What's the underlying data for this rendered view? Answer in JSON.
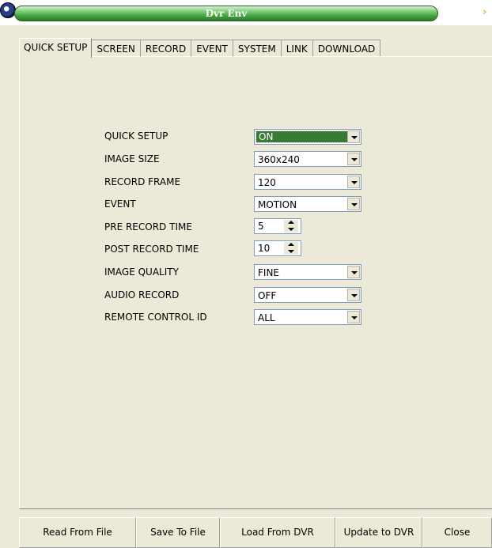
{
  "window": {
    "title": "Dvr Env",
    "close_glyph": "›"
  },
  "tabs": [
    {
      "label": "QUICK SETUP",
      "active": true
    },
    {
      "label": "SCREEN",
      "active": false
    },
    {
      "label": "RECORD",
      "active": false
    },
    {
      "label": "EVENT",
      "active": false
    },
    {
      "label": "SYSTEM",
      "active": false
    },
    {
      "label": "LINK",
      "active": false
    },
    {
      "label": "DOWNLOAD",
      "active": false
    }
  ],
  "form": {
    "quick_setup": {
      "label": "QUICK SETUP",
      "value": "ON"
    },
    "image_size": {
      "label": "IMAGE SIZE",
      "value": "360x240"
    },
    "record_frame": {
      "label": "RECORD FRAME",
      "value": "120"
    },
    "event": {
      "label": "EVENT",
      "value": "MOTION"
    },
    "pre_record_time": {
      "label": "PRE RECORD TIME",
      "value": "5"
    },
    "post_record_time": {
      "label": "POST RECORD TIME",
      "value": "10"
    },
    "image_quality": {
      "label": "IMAGE QUALITY",
      "value": "FINE"
    },
    "audio_record": {
      "label": "AUDIO RECORD",
      "value": "OFF"
    },
    "remote_control_id": {
      "label": "REMOTE CONTROL ID",
      "value": "ALL"
    }
  },
  "buttons": {
    "read_from_file": "Read From File",
    "save_to_file": "Save To File",
    "load_from_dvr": "Load From DVR",
    "update_to_dvr": "Update to DVR",
    "close": "Close"
  },
  "colors": {
    "title_green": "#3c9f3a",
    "selection_green": "#3a7a37",
    "dialog_bg": "#ece9d8"
  },
  "icons": {
    "app_logo": "app-logo-icon",
    "dropdown_arrow": "chevron-down-icon",
    "spin_up": "spin-up-icon",
    "spin_down": "spin-down-icon"
  }
}
